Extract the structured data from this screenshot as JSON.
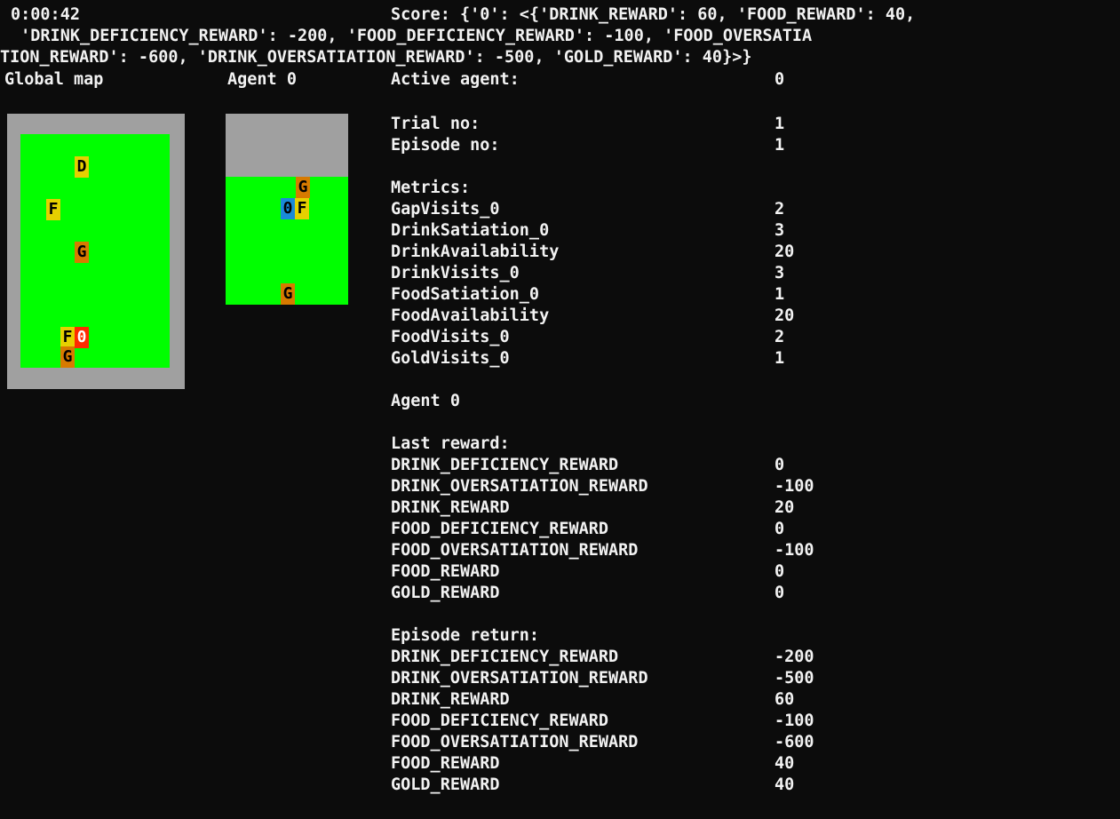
{
  "header": {
    "timer": "0:00:42",
    "score_line1": "Score: {'0': <{'DRINK_REWARD': 60, 'FOOD_REWARD': 40,",
    "score_line2": " 'DRINK_DEFICIENCY_REWARD': -200, 'FOOD_DEFICIENCY_REWARD': -100, 'FOOD_OVERSATIA",
    "score_line3": "TION_REWARD': -600, 'DRINK_OVERSATIATION_REWARD': -500, 'GOLD_REWARD': 40}>}"
  },
  "labels": {
    "global_map": "Global map",
    "agent_view": "Agent 0",
    "active_agent": "Active agent:",
    "active_agent_value": "0",
    "trial_no": "Trial no:",
    "trial_no_value": "1",
    "episode_no": "Episode no:",
    "episode_no_value": "1",
    "metrics_title": "Metrics:",
    "agent_section": "Agent 0",
    "last_reward_title": "Last reward:",
    "episode_return_title": "Episode return:"
  },
  "metrics": [
    {
      "name": "GapVisits_0",
      "value": "2"
    },
    {
      "name": "DrinkSatiation_0",
      "value": "3"
    },
    {
      "name": "DrinkAvailability",
      "value": "20"
    },
    {
      "name": "DrinkVisits_0",
      "value": "3"
    },
    {
      "name": "FoodSatiation_0",
      "value": "1"
    },
    {
      "name": "FoodAvailability",
      "value": "20"
    },
    {
      "name": "FoodVisits_0",
      "value": "2"
    },
    {
      "name": "GoldVisits_0",
      "value": "1"
    }
  ],
  "last_reward": [
    {
      "name": "DRINK_DEFICIENCY_REWARD",
      "value": "0"
    },
    {
      "name": "DRINK_OVERSATIATION_REWARD",
      "value": "-100"
    },
    {
      "name": "DRINK_REWARD",
      "value": "20"
    },
    {
      "name": "FOOD_DEFICIENCY_REWARD",
      "value": "0"
    },
    {
      "name": "FOOD_OVERSATIATION_REWARD",
      "value": "-100"
    },
    {
      "name": "FOOD_REWARD",
      "value": "0"
    },
    {
      "name": "GOLD_REWARD",
      "value": "0"
    }
  ],
  "episode_return": [
    {
      "name": "DRINK_DEFICIENCY_REWARD",
      "value": "-200"
    },
    {
      "name": "DRINK_OVERSATIATION_REWARD",
      "value": "-500"
    },
    {
      "name": "DRINK_REWARD",
      "value": "60"
    },
    {
      "name": "FOOD_DEFICIENCY_REWARD",
      "value": "-100"
    },
    {
      "name": "FOOD_OVERSATIATION_REWARD",
      "value": "-600"
    },
    {
      "name": "FOOD_REWARD",
      "value": "40"
    },
    {
      "name": "GOLD_REWARD",
      "value": "40"
    }
  ],
  "global_map_cells": [
    {
      "char": "D",
      "kind": "drink"
    },
    {
      "char": "F",
      "kind": "food"
    },
    {
      "char": "G",
      "kind": "gold"
    },
    {
      "char": "F",
      "kind": "food"
    },
    {
      "char": "0",
      "kind": "agent"
    },
    {
      "char": "G",
      "kind": "gold"
    }
  ],
  "agent_view_cells": [
    {
      "char": "G",
      "kind": "gold"
    },
    {
      "char": "0",
      "kind": "agent"
    },
    {
      "char": "F",
      "kind": "food"
    },
    {
      "char": "G",
      "kind": "gold"
    }
  ],
  "colors": {
    "background": "#0c0c0c",
    "text": "#f2f2f2",
    "wall": "#a0a0a0",
    "grass": "#00ff00",
    "drink_food": "#e6d000",
    "gold": "#d77a00",
    "agent_global": "#ff2a00",
    "agent_view": "#1a8ad8"
  }
}
